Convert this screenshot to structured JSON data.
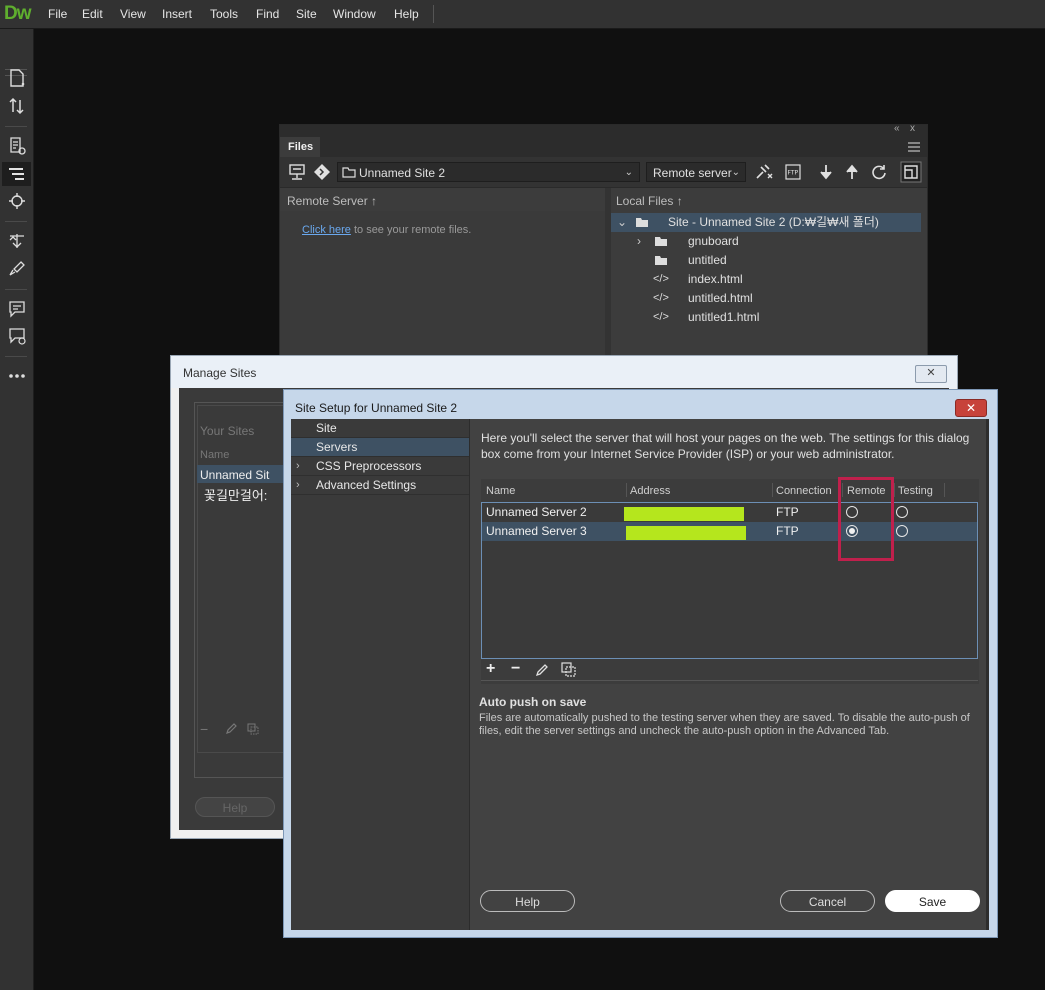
{
  "app": {
    "logo": "Dw"
  },
  "menu": [
    "File",
    "Edit",
    "View",
    "Insert",
    "Tools",
    "Find",
    "Site",
    "Window",
    "Help"
  ],
  "files_panel": {
    "tab": "Files",
    "site_dropdown": "Unnamed Site 2",
    "view_dropdown": "Remote server",
    "remote_header": "Remote Server",
    "local_header": "Local Files",
    "remote_link": "Click here",
    "remote_text": " to see your remote files.",
    "tree": [
      {
        "label": "Site - Unnamed Site 2 (D:₩길₩새 폴더)",
        "icon": "folder-icon",
        "expand": "⌄",
        "selected": true
      },
      {
        "label": "gnuboard",
        "icon": "folder-icon",
        "expand": "›"
      },
      {
        "label": "untitled",
        "icon": "folder-icon",
        "expand": ""
      },
      {
        "label": "index.html",
        "icon": "code-file-icon",
        "expand": ""
      },
      {
        "label": "untitled.html",
        "icon": "code-file-icon",
        "expand": ""
      },
      {
        "label": "untitled1.html",
        "icon": "code-file-icon",
        "expand": ""
      }
    ]
  },
  "manage_sites": {
    "title": "Manage Sites",
    "close": "✕",
    "your_sites": "Your Sites",
    "name_header": "Name",
    "sites": [
      "Unnamed Sit",
      "꽃길만걸어:"
    ],
    "help": "Help"
  },
  "site_setup": {
    "title": "Site Setup for Unnamed Site 2",
    "close": "✕",
    "nav": [
      {
        "label": "Site",
        "chevron": ""
      },
      {
        "label": "Servers",
        "chevron": "",
        "active": true
      },
      {
        "label": "CSS Preprocessors",
        "chevron": "›"
      },
      {
        "label": "Advanced Settings",
        "chevron": "›"
      }
    ],
    "description": "Here you'll select the server that will host your pages on the web. The settings for this dialog box come from your Internet Service Provider (ISP) or your web administrator.",
    "columns": [
      "Name",
      "Address",
      "Connection",
      "Remote",
      "Testing"
    ],
    "servers": [
      {
        "name": "Unnamed Server 2",
        "connection": "FTP",
        "remote": false,
        "testing": false
      },
      {
        "name": "Unnamed Server 3",
        "connection": "FTP",
        "remote": true,
        "testing": false,
        "selected": true
      }
    ],
    "tools": [
      "+",
      "−"
    ],
    "autopush_title": "Auto push on save",
    "autopush_text": "Files are automatically pushed to the testing server when they are saved. To disable the auto-push of files, edit the server settings and uncheck the auto-push option in the Advanced Tab.",
    "buttons": {
      "help": "Help",
      "cancel": "Cancel",
      "save": "Save"
    }
  },
  "colors": {
    "highlight": "#b5e61d",
    "annotation": "#c0204c",
    "selection": "#3e5163",
    "accent": "#5fae2e"
  }
}
